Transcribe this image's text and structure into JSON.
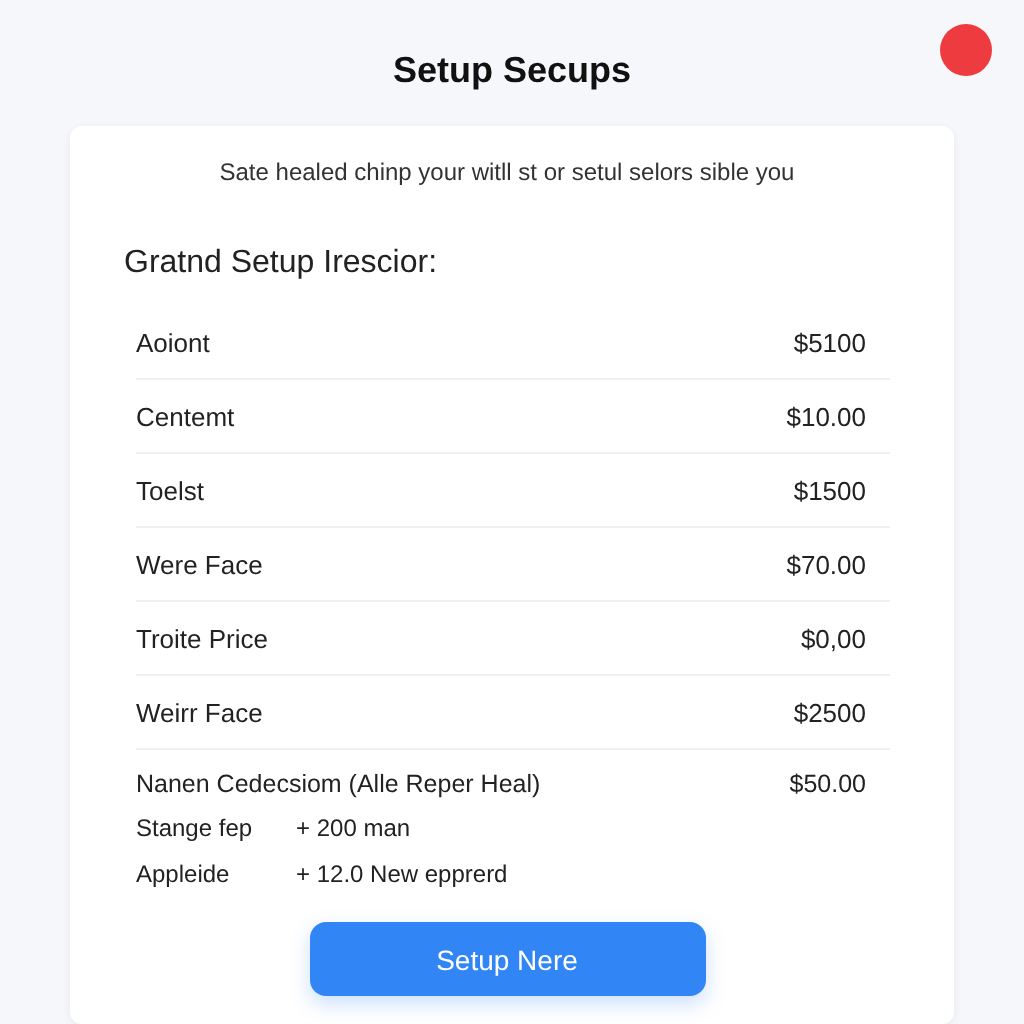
{
  "title": "Setup Secups",
  "card": {
    "subtitle": "Sate healed chinp your witll st or setul selors sible you",
    "heading": "Gratnd Setup Irescior:",
    "rows": [
      {
        "label": "Aoiont",
        "value": "$5100"
      },
      {
        "label": "Centemt",
        "value": "$10.00"
      },
      {
        "label": "Toelst",
        "value": "$1500"
      },
      {
        "label": "Were Face",
        "value": "$70.00"
      },
      {
        "label": "Troite Price",
        "value": "$0,00"
      },
      {
        "label": "Weirr Face",
        "value": "$2500"
      }
    ],
    "summary": {
      "label": "Nanen Cedecsiom (Alle Reper Heal)",
      "value": "$50.00"
    },
    "details": [
      {
        "label": "Stange fep",
        "value": "+ 200 man"
      },
      {
        "label": "Appleide",
        "value": "+ 12.0 New epprerd"
      }
    ],
    "button": "Setup Nere"
  }
}
